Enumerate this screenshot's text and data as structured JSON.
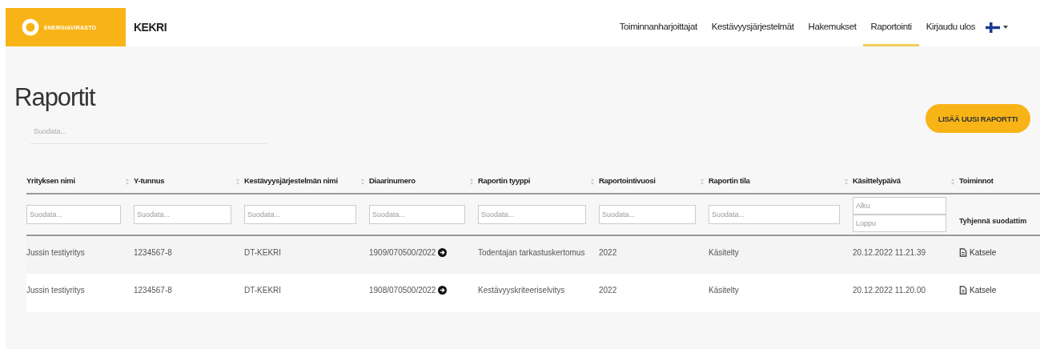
{
  "header": {
    "logo_text": "ENERGIAVIRASTO",
    "app_name": "KEKRI",
    "nav": [
      {
        "label": "Toiminnanharjoittajat",
        "selected": false
      },
      {
        "label": "Kestävyysjärjestelmät",
        "selected": false
      },
      {
        "label": "Hakemukset",
        "selected": false
      },
      {
        "label": "Raportointi",
        "selected": true
      },
      {
        "label": "Kirjaudu ulos",
        "selected": false
      }
    ]
  },
  "page": {
    "title": "Raportit",
    "search": {
      "placeholder": "Suodata..."
    },
    "add_button": "LISÄÄ UUSI RAPORTTI"
  },
  "table": {
    "columns": [
      {
        "label": "Yrityksen nimi",
        "filter": {
          "kind": "text",
          "placeholder": "Suodata..."
        }
      },
      {
        "label": "Y-tunnus",
        "filter": {
          "kind": "text",
          "placeholder": "Suodata..."
        }
      },
      {
        "label": "Kestävyysjärjestelmän nimi",
        "filter": {
          "kind": "text",
          "placeholder": "Suodata..."
        }
      },
      {
        "label": "Diaarinumero",
        "filter": {
          "kind": "text",
          "placeholder": "Suodata..."
        }
      },
      {
        "label": "Raportin tyyppi",
        "filter": {
          "kind": "text",
          "placeholder": "Suodata..."
        }
      },
      {
        "label": "Raportointivuosi",
        "filter": {
          "kind": "text",
          "placeholder": "Suodata..."
        }
      },
      {
        "label": "Raportin tila",
        "filter": {
          "kind": "text",
          "placeholder": "Suodata..."
        }
      },
      {
        "label": "Käsittelypäivä",
        "filter": {
          "kind": "daterange",
          "start_placeholder": "Alku",
          "end_placeholder": "Loppu"
        }
      },
      {
        "label": "Toiminnot",
        "filter": {
          "kind": "clear",
          "label": "Tyhjennä suodattim"
        }
      }
    ],
    "rows": [
      {
        "company": "Jussin testiyritys",
        "business_id": "1234567-8",
        "system": "DT-KEKRI",
        "diary_number": "1909/070500/2022",
        "report_type": "Todentajan tarkastuskertomus",
        "year": "2022",
        "status": "Käsitelty",
        "processed": "20.12.2022 11.21.39",
        "action": "Katsele"
      },
      {
        "company": "Jussin testiyritys",
        "business_id": "1234567-8",
        "system": "DT-KEKRI",
        "diary_number": "1908/070500/2022",
        "report_type": "Kestävyyskriteeriselvitys",
        "year": "2022",
        "status": "Käsitelty",
        "processed": "20.12.2022 11.20.00",
        "action": "Katsele"
      }
    ]
  }
}
